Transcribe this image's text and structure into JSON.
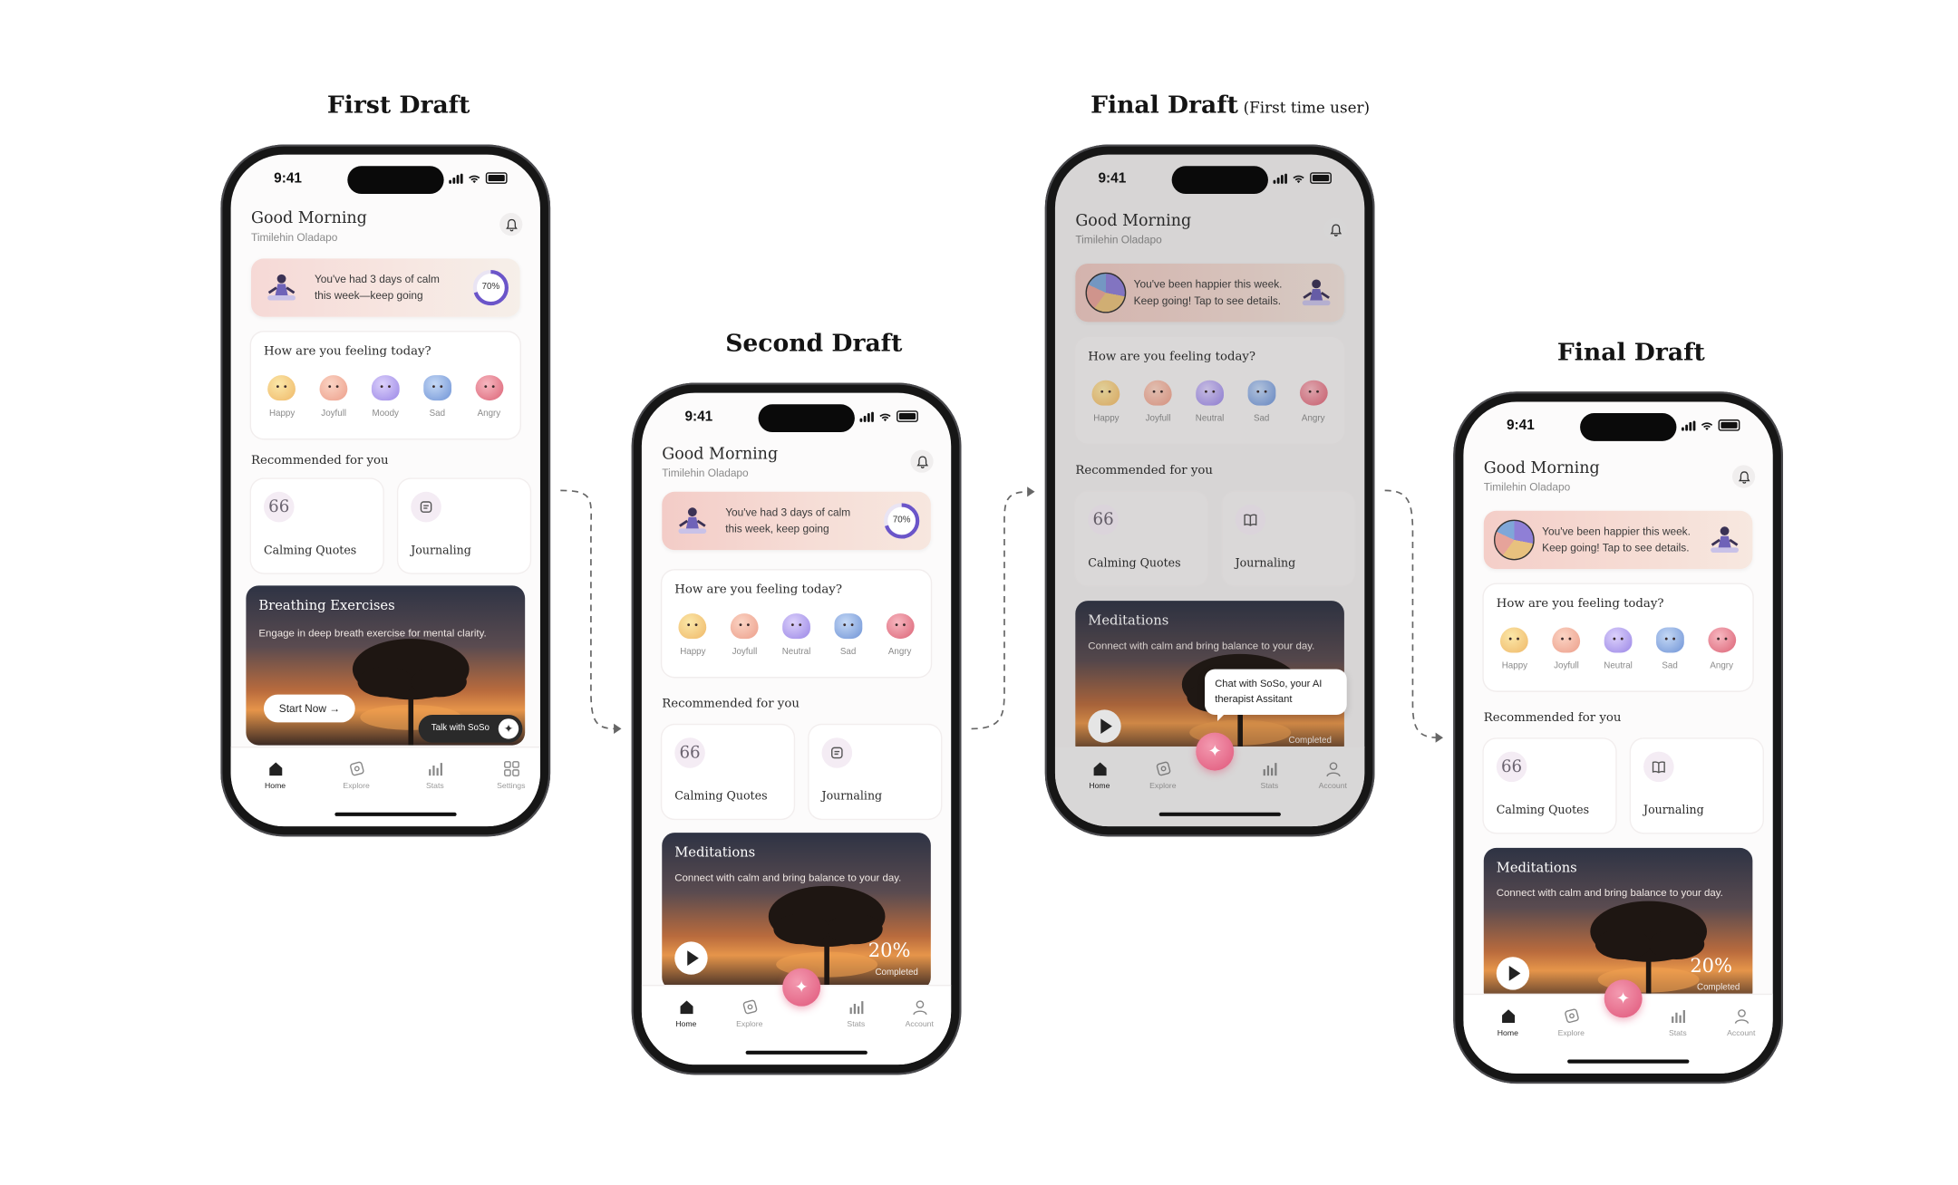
{
  "headings": {
    "first": "First Draft",
    "second": "Second Draft",
    "final_first": "Final Draft",
    "final_first_note": "(First time user)",
    "final": "Final Draft"
  },
  "status_time": "9:41",
  "greeting": "Good Morning",
  "user_name": "Timilehin Oladapo",
  "mood_question": "How are you feeling today?",
  "recommended_title": "Recommended for you",
  "quote_icon": "66",
  "calming_quotes": "Calming Quotes",
  "journaling": "Journaling",
  "accent": "#e0567a",
  "icons": [
    "bell-icon",
    "home-icon",
    "explore-icon",
    "stats-icon",
    "settings-icon",
    "account-icon",
    "sparkle-icon",
    "play-icon",
    "journal-icon",
    "quote-icon"
  ],
  "phone1": {
    "banner_line1": "You've had 3 days of calm",
    "banner_line2": "this week—keep going",
    "progress": "70%",
    "moods": [
      "Happy",
      "Joyfull",
      "Moody",
      "Sad",
      "Angry"
    ],
    "hero_title": "Breathing Exercises",
    "hero_sub": "Engage in deep breath exercise for mental clarity.",
    "start_button": "Start Now  →",
    "talk_pill": "Talk with SoSo",
    "nav": [
      "Home",
      "Explore",
      "Stats",
      "Settings"
    ]
  },
  "phone2": {
    "banner_line1": "You've had 3 days of calm",
    "banner_line2": "this week, keep going",
    "progress": "70%",
    "moods": [
      "Happy",
      "Joyfull",
      "Neutral",
      "Sad",
      "Angry"
    ],
    "hero_title": "Meditations",
    "hero_sub": "Connect with calm and bring balance to your day.",
    "completion": "20%",
    "completion_label": "Completed",
    "nav": [
      "Home",
      "Explore",
      "Stats",
      "Account"
    ]
  },
  "phone3": {
    "banner_line1": "You've been happier this week.",
    "banner_line2": "Keep going! Tap to see details.",
    "moods": [
      "Happy",
      "Joyfull",
      "Neutral",
      "Sad",
      "Angry"
    ],
    "hero_title": "Meditations",
    "hero_sub": "Connect with calm and bring balance to your day.",
    "completion_label": "Completed",
    "tooltip": "Chat with SoSo, your AI therapist Assitant",
    "nav": [
      "Home",
      "Explore",
      "Stats",
      "Account"
    ]
  },
  "phone4": {
    "banner_line1": "You've been happier this week.",
    "banner_line2": "Keep going! Tap to see details.",
    "moods": [
      "Happy",
      "Joyfull",
      "Neutral",
      "Sad",
      "Angry"
    ],
    "hero_title": "Meditations",
    "hero_sub": "Connect with calm and bring balance to your day.",
    "completion": "20%",
    "completion_label": "Completed",
    "nav": [
      "Home",
      "Explore",
      "Stats",
      "Account"
    ]
  }
}
